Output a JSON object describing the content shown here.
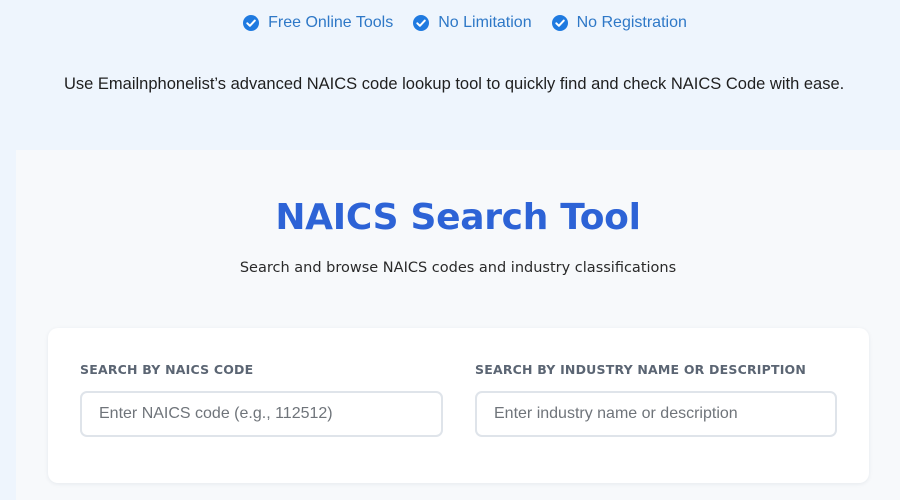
{
  "features": [
    {
      "label": "Free Online Tools",
      "icon": "check-circle-icon"
    },
    {
      "label": "No Limitation",
      "icon": "check-circle-icon"
    },
    {
      "label": "No Registration",
      "icon": "check-circle-icon"
    }
  ],
  "intro_text": "Use Emailnphonelist’s advanced NAICS code lookup tool to quickly find and check NAICS Code with ease.",
  "tool": {
    "title": "NAICS Search Tool",
    "subtitle": "Search and browse NAICS codes and industry classifications"
  },
  "search": {
    "code": {
      "label": "SEARCH BY NAICS CODE",
      "placeholder": "Enter NAICS code (e.g., 112512)",
      "value": ""
    },
    "industry": {
      "label": "SEARCH BY INDUSTRY NAME OR DESCRIPTION",
      "placeholder": "Enter industry name or description",
      "value": ""
    }
  },
  "colors": {
    "accent": "#2d63d6",
    "feature_text": "#2e78c7",
    "check_icon": "#1f7ae0",
    "page_bg": "#eef5fd"
  }
}
